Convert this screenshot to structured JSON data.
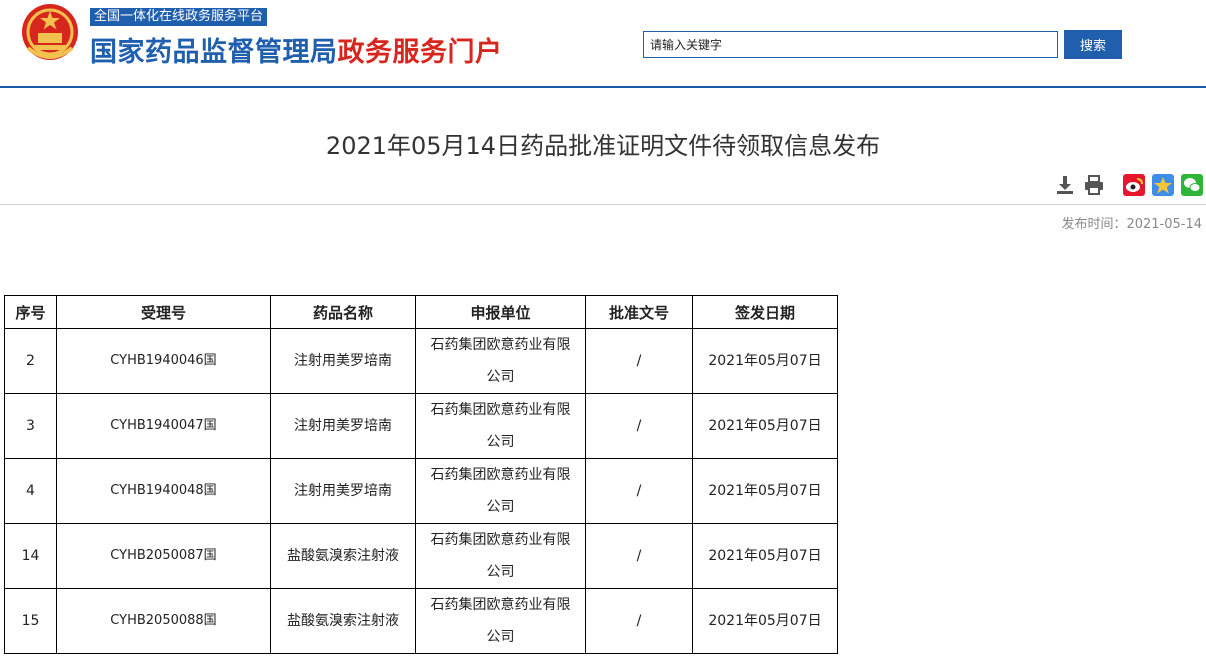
{
  "header": {
    "platform_badge": "全国一体化在线政务服务平台",
    "title_blue": "国家药品监督管理局",
    "title_red": "政务服务门户",
    "search_placeholder": "请输入关键字",
    "search_button": "搜索"
  },
  "colors": {
    "brand_blue": "#1f5fae",
    "brand_red": "#d7261e"
  },
  "article": {
    "title": "2021年05月14日药品批准证明文件待领取信息发布",
    "publish_label": "发布时间：2021-05-14"
  },
  "toolbar": {
    "icons": [
      "download-icon",
      "print-icon",
      "weibo-share-icon",
      "qzone-share-icon",
      "wechat-share-icon"
    ]
  },
  "table": {
    "headers": [
      "序号",
      "受理号",
      "药品名称",
      "申报单位",
      "批准文号",
      "签发日期"
    ],
    "rows": [
      [
        "2",
        "CYHB1940046国",
        "注射用美罗培南",
        "石药集团欧意药业有限公司",
        "/",
        "2021年05月07日"
      ],
      [
        "3",
        "CYHB1940047国",
        "注射用美罗培南",
        "石药集团欧意药业有限公司",
        "/",
        "2021年05月07日"
      ],
      [
        "4",
        "CYHB1940048国",
        "注射用美罗培南",
        "石药集团欧意药业有限公司",
        "/",
        "2021年05月07日"
      ],
      [
        "14",
        "CYHB2050087国",
        "盐酸氨溴索注射液",
        "石药集团欧意药业有限公司",
        "/",
        "2021年05月07日"
      ],
      [
        "15",
        "CYHB2050088国",
        "盐酸氨溴索注射液",
        "石药集团欧意药业有限公司",
        "/",
        "2021年05月07日"
      ]
    ]
  }
}
